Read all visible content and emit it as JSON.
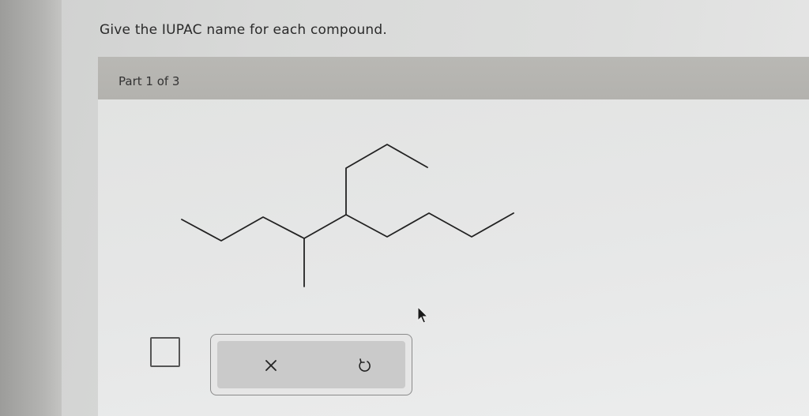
{
  "question": {
    "text": "Give the IUPAC name for each compound."
  },
  "part": {
    "label": "Part 1 of 3"
  },
  "toolbar": {
    "clear_icon": "x-icon",
    "undo_icon": "undo-icon"
  },
  "colors": {
    "header_bg": "#b5b4b0",
    "panel_bg": "#e5e6e6",
    "toolbar_inner": "#cacaca"
  }
}
